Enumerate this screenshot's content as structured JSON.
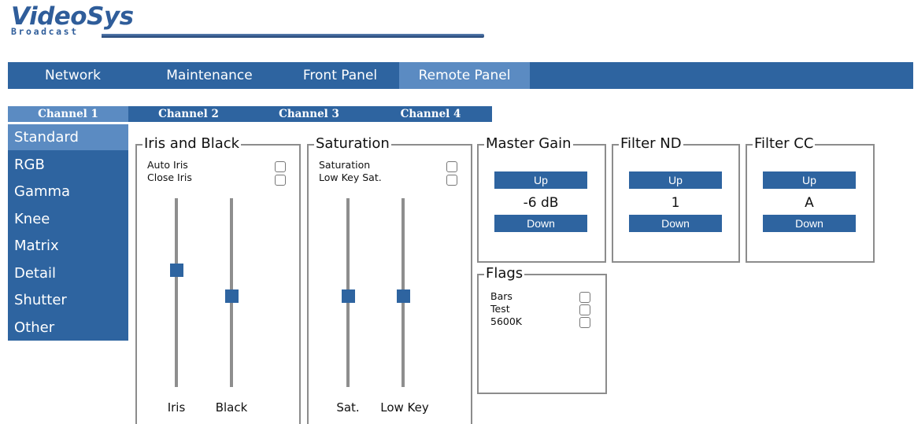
{
  "logo": {
    "main": "VideoSys",
    "sub": "Broadcast"
  },
  "main_nav": [
    "Network",
    "Maintenance",
    "Front Panel",
    "Remote Panel"
  ],
  "main_nav_active": "Remote Panel",
  "channels": [
    "Channel 1",
    "Channel 2",
    "Channel 3",
    "Channel 4"
  ],
  "channel_active": "Channel 1",
  "side_menu": [
    "Standard",
    "RGB",
    "Gamma",
    "Knee",
    "Matrix",
    "Detail",
    "Shutter",
    "Other"
  ],
  "side_menu_active": "Standard",
  "iris_black": {
    "title": "Iris and Black",
    "auto_iris_label": "Auto Iris",
    "close_iris_label": "Close Iris",
    "auto_iris_checked": false,
    "close_iris_checked": false,
    "iris_label": "Iris",
    "black_label": "Black"
  },
  "saturation": {
    "title": "Saturation",
    "saturation_label": "Saturation",
    "low_key_sat_label": "Low Key Sat.",
    "saturation_checked": false,
    "low_key_sat_checked": false,
    "sat_label": "Sat.",
    "low_key_label": "Low Key"
  },
  "master_gain": {
    "title": "Master Gain",
    "up": "Up",
    "value": "-6 dB",
    "down": "Down"
  },
  "filter_nd": {
    "title": "Filter ND",
    "up": "Up",
    "value": "1",
    "down": "Down"
  },
  "filter_cc": {
    "title": "Filter CC",
    "up": "Up",
    "value": "A",
    "down": "Down"
  },
  "flags": {
    "title": "Flags",
    "items": [
      {
        "label": "Bars",
        "checked": false
      },
      {
        "label": "Test",
        "checked": false
      },
      {
        "label": "5600K",
        "checked": false
      }
    ]
  },
  "colors": {
    "nav_blue": "#2e64a0",
    "active_blue": "#5b8bc2",
    "border_gray": "#8c8c8c"
  }
}
